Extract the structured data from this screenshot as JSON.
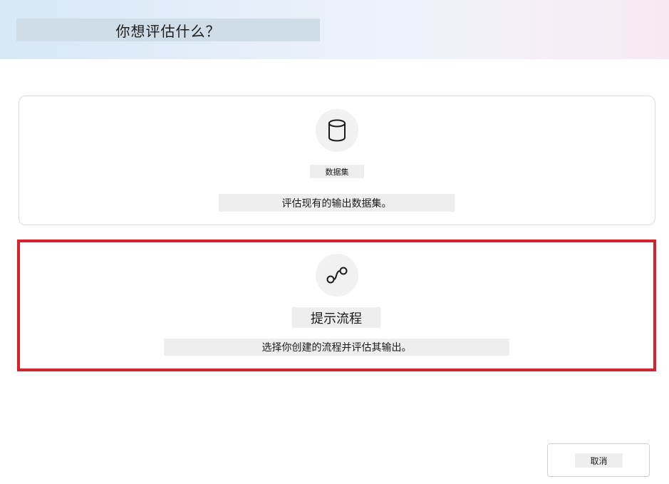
{
  "header": {
    "title": "你想评估什么？"
  },
  "options": [
    {
      "icon": "database-icon",
      "label": "数据集",
      "description": "评估现有的输出数据集。",
      "selected": false
    },
    {
      "icon": "flow-icon",
      "label": "提示流程",
      "description": "选择你创建的流程并评估其输出。",
      "selected": true
    }
  ],
  "footer": {
    "cancel_label": "取消"
  },
  "colors": {
    "selection_border": "#d9202b",
    "card_border": "#dcdcdc",
    "header_gradient_start": "#d6e7f6",
    "header_gradient_end": "#f6e9f2"
  }
}
